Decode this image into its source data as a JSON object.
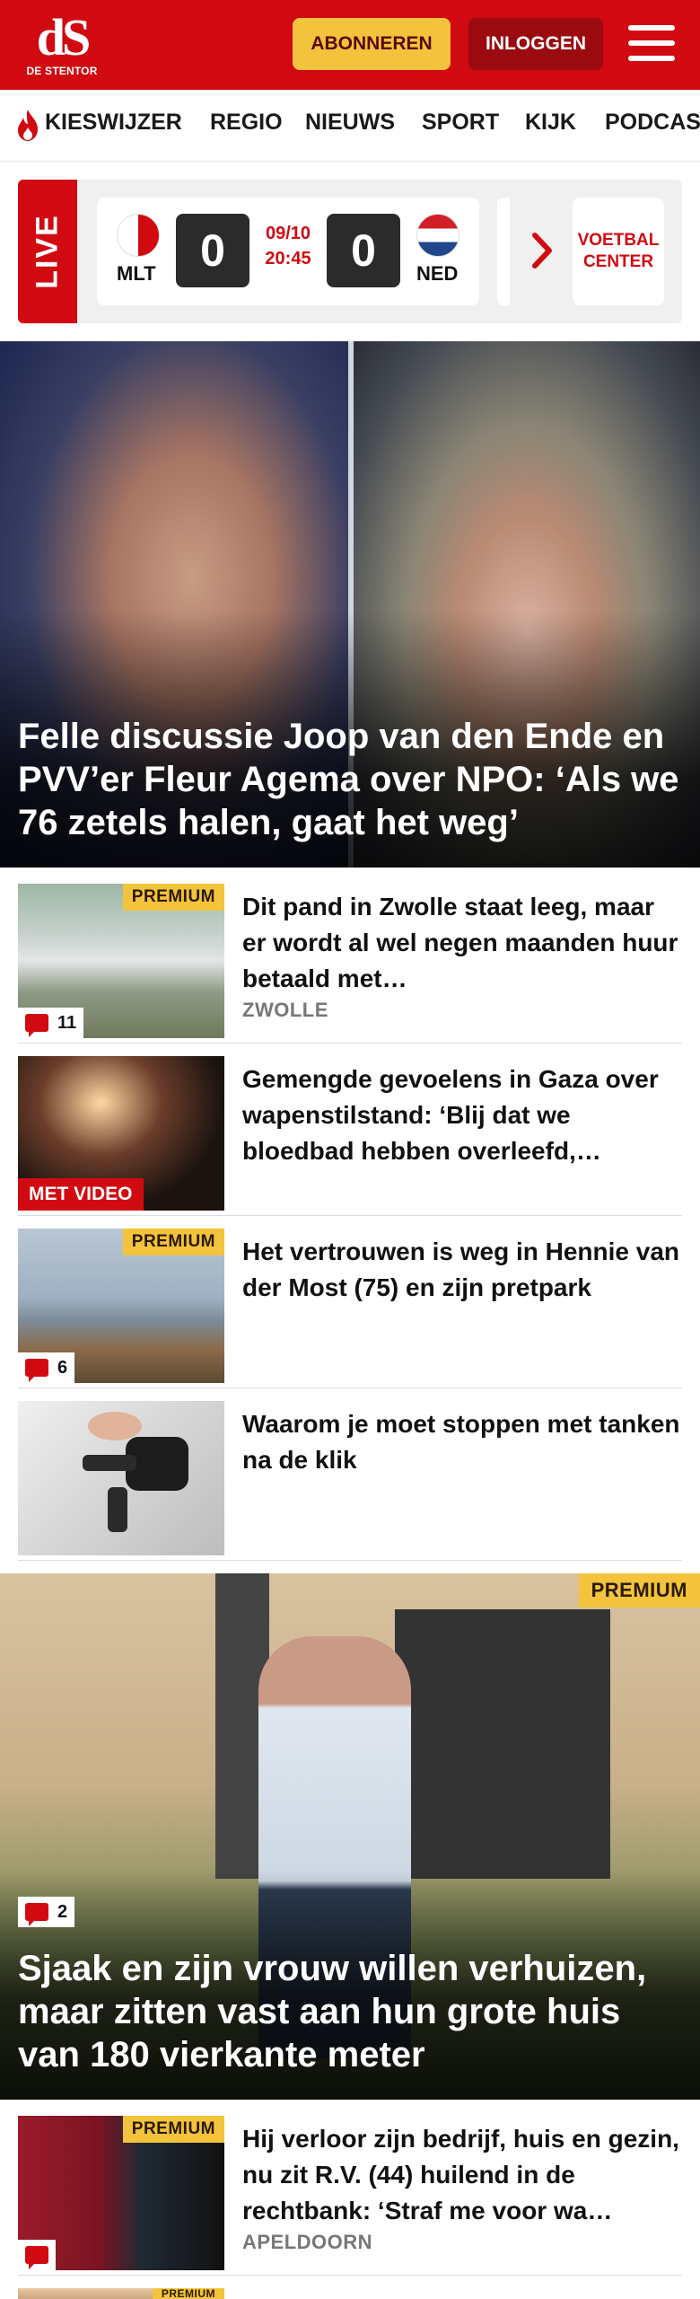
{
  "header": {
    "logo_mark": "dS",
    "logo_sub": "DE STENTOR",
    "subscribe_label": "ABONNEREN",
    "login_label": "INLOGGEN",
    "brand_color": "#d10a11",
    "accent_color": "#f3c33b"
  },
  "nav": {
    "items": [
      {
        "label": "KIESWIJZER",
        "icon": "flame-icon"
      },
      {
        "label": "REGIO"
      },
      {
        "label": "NIEUWS"
      },
      {
        "label": "SPORT"
      },
      {
        "label": "KIJK"
      },
      {
        "label": "PODCAS"
      }
    ]
  },
  "live": {
    "tag": "LIVE",
    "home_code": "MLT",
    "home_score": "0",
    "away_code": "NED",
    "away_score": "0",
    "date": "09/10",
    "time": "20:45",
    "center_label_1": "VOETBAL",
    "center_label_2": "CENTER"
  },
  "hero": {
    "title": "Felle discussie Joop van den Ende en PVV’er Fleur Agema over NPO: ‘Als we 76 zetels halen, gaat het weg’"
  },
  "articles": [
    {
      "title": "Dit pand in Zwolle staat leeg, maar er wordt al wel negen maanden huur betaald met…",
      "tag": "ZWOLLE",
      "premium": "PREMIUM",
      "comments": "11"
    },
    {
      "title": "Gemengde gevoelens in Gaza over wapenstilstand: ‘Blij dat we bloedbad hebben overleefd,…",
      "badge": "MET VIDEO"
    },
    {
      "title": "Het vertrouwen is weg in Hennie van der Most (75) en zijn pretpark",
      "premium": "PREMIUM",
      "comments": "6"
    },
    {
      "title": "Waarom je moet stoppen met tanken na de klik"
    }
  ],
  "feature": {
    "title": "Sjaak en zijn vrouw willen verhuizen, maar zitten vast aan hun grote huis van 180 vierkante meter",
    "premium": "PREMIUM",
    "comments": "2"
  },
  "articles2": [
    {
      "title": "Hij verloor zijn bedrijf, huis en gezin, nu zit R.V. (44) huilend in de rechtbank: ‘Straf me voor wa…",
      "tag": "APELDOORN",
      "premium": "PREMIUM"
    },
    {
      "premium": "PREMIUM"
    }
  ]
}
